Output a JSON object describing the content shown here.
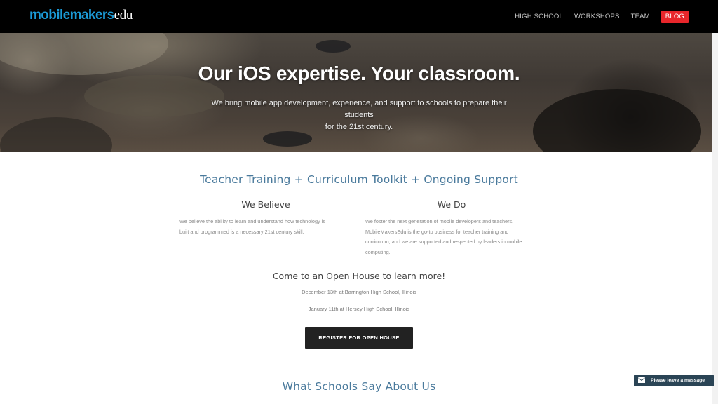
{
  "header": {
    "logo_part1": "mobilemakers",
    "logo_part2": "edu",
    "nav": [
      {
        "label": "HIGH SCHOOL"
      },
      {
        "label": "WORKSHOPS"
      },
      {
        "label": "TEAM"
      },
      {
        "label": "BLOG"
      }
    ]
  },
  "hero": {
    "title": "Our iOS expertise. Your classroom.",
    "subtitle_line1": "We bring mobile app development, experience, and support to schools to prepare their students",
    "subtitle_line2": "for the 21st century."
  },
  "main": {
    "tagline": "Teacher Training + Curriculum Toolkit + Ongoing Support",
    "believe_title": "We Believe",
    "believe_lines": [
      "We believe the ability to learn and understand how technology is",
      "built and programmed is a necessary 21st century skill."
    ],
    "do_title": "We Do",
    "do_lines": [
      "We foster the next generation of mobile developers and teachers.",
      "MobileMakersEdu is the go-to business for teacher training and",
      "curriculum, and we are supported and respected by leaders in mobile",
      "computing."
    ],
    "openhouse_title": "Come to an Open House to learn more!",
    "events": [
      "December 13th at Barrington High School, Illinois",
      "January 11th at Hersey High School, Illinois"
    ],
    "register_label": "REGISTER FOR OPEN HOUSE",
    "testimonials_title": "What Schools Say About Us"
  },
  "chat": {
    "label": "Please leave a message",
    "icon": "envelope-icon"
  },
  "colors": {
    "accent_blue": "#4a7a9c",
    "logo_blue": "#1b9ad6",
    "blog_red": "#e8262b",
    "chat_bg": "#2a4455"
  }
}
